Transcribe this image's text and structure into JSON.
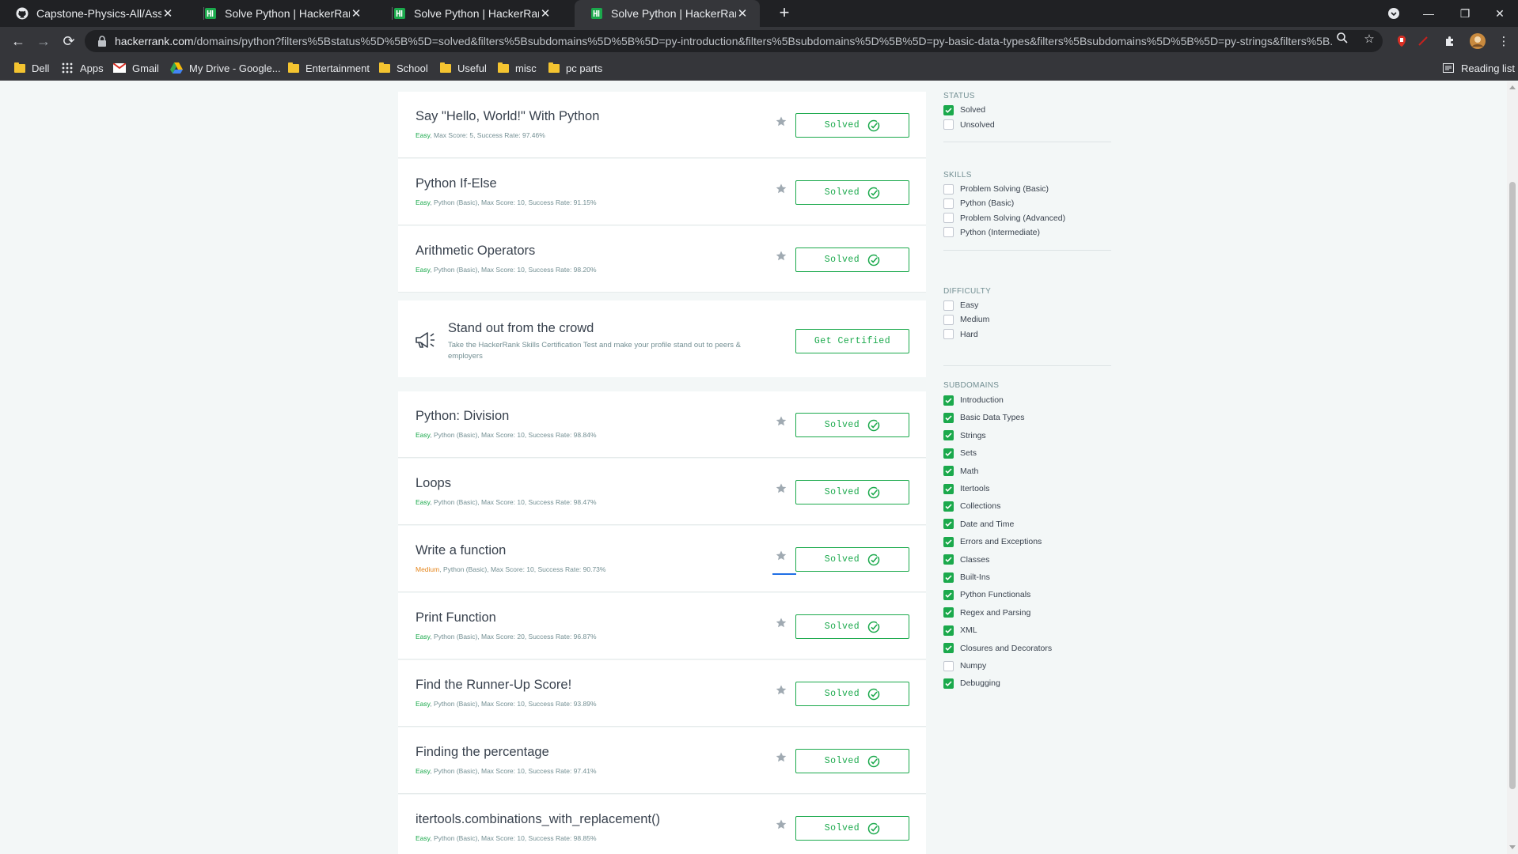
{
  "browser": {
    "tabs": [
      {
        "title": "Capstone-Physics-All/Assignmen",
        "icon": "github-icon",
        "active": false
      },
      {
        "title": "Solve Python | HackerRank",
        "icon": "hackerrank-icon",
        "active": false
      },
      {
        "title": "Solve Python | HackerRank",
        "icon": "hackerrank-icon",
        "active": false
      },
      {
        "title": "Solve Python | HackerRank",
        "icon": "hackerrank-icon",
        "active": true
      }
    ],
    "url_host": "hackerrank.com",
    "url_path": "/domains/python?filters%5Bstatus%5D%5B%5D=solved&filters%5Bsubdomains%5D%5B%5D=py-introduction&filters%5Bsubdomains%5D%5B%5D=py-basic-data-types&filters%5Bsubdomains%5D%5B%5D=py-strings&filters%5B...",
    "bookmarks": [
      "Dell",
      "Apps",
      "Gmail",
      "My Drive - Google...",
      "Entertainment",
      "School",
      "Useful",
      "misc",
      "pc parts"
    ],
    "reading_list": "Reading list",
    "colors": {
      "brand": "#1ba94c",
      "medium": "#e5861d",
      "frame": "#202124",
      "toolbar": "#35363a"
    }
  },
  "challenges": [
    {
      "title": "Say \"Hello, World!\" With Python",
      "difficulty": "Easy",
      "meta": ", Max Score: 5, Success Rate: 97.46%",
      "status": "Solved"
    },
    {
      "title": "Python If-Else",
      "difficulty": "Easy",
      "meta": ", Python (Basic), Max Score: 10, Success Rate: 91.15%",
      "status": "Solved"
    },
    {
      "title": "Arithmetic Operators",
      "difficulty": "Easy",
      "meta": ", Python (Basic), Max Score: 10, Success Rate: 98.20%",
      "status": "Solved"
    },
    {
      "title": "Python: Division",
      "difficulty": "Easy",
      "meta": ", Python (Basic), Max Score: 10, Success Rate: 98.84%",
      "status": "Solved"
    },
    {
      "title": "Loops",
      "difficulty": "Easy",
      "meta": ", Python (Basic), Max Score: 10, Success Rate: 98.47%",
      "status": "Solved"
    },
    {
      "title": "Write a function",
      "difficulty": "Medium",
      "meta": ", Python (Basic), Max Score: 10, Success Rate: 90.73%",
      "status": "Solved"
    },
    {
      "title": "Print Function",
      "difficulty": "Easy",
      "meta": ", Python (Basic), Max Score: 20, Success Rate: 96.87%",
      "status": "Solved"
    },
    {
      "title": "Find the Runner-Up Score!",
      "difficulty": "Easy",
      "meta": ", Python (Basic), Max Score: 10, Success Rate: 93.89%",
      "status": "Solved"
    },
    {
      "title": "Finding the percentage",
      "difficulty": "Easy",
      "meta": ", Python (Basic), Max Score: 10, Success Rate: 97.41%",
      "status": "Solved"
    },
    {
      "title": "itertools.combinations_with_replacement()",
      "difficulty": "Easy",
      "meta": ", Python (Basic), Max Score: 10, Success Rate: 98.85%",
      "status": "Solved"
    }
  ],
  "promo": {
    "title": "Stand out from the crowd",
    "description": "Take the HackerRank Skills Certification Test and make your profile stand out to peers & employers",
    "button": "Get Certified"
  },
  "filters": {
    "status": {
      "heading": "STATUS",
      "options": [
        {
          "label": "Solved",
          "checked": true
        },
        {
          "label": "Unsolved",
          "checked": false
        }
      ]
    },
    "skills": {
      "heading": "SKILLS",
      "options": [
        {
          "label": "Problem Solving (Basic)",
          "checked": false
        },
        {
          "label": "Python (Basic)",
          "checked": false
        },
        {
          "label": "Problem Solving (Advanced)",
          "checked": false
        },
        {
          "label": "Python (Intermediate)",
          "checked": false
        }
      ]
    },
    "difficulty": {
      "heading": "DIFFICULTY",
      "options": [
        {
          "label": "Easy",
          "checked": false
        },
        {
          "label": "Medium",
          "checked": false
        },
        {
          "label": "Hard",
          "checked": false
        }
      ]
    },
    "subdomains": {
      "heading": "SUBDOMAINS",
      "options": [
        {
          "label": "Introduction",
          "checked": true
        },
        {
          "label": "Basic Data Types",
          "checked": true
        },
        {
          "label": "Strings",
          "checked": true
        },
        {
          "label": "Sets",
          "checked": true
        },
        {
          "label": "Math",
          "checked": true
        },
        {
          "label": "Itertools",
          "checked": true
        },
        {
          "label": "Collections",
          "checked": true
        },
        {
          "label": "Date and Time",
          "checked": true
        },
        {
          "label": "Errors and Exceptions",
          "checked": true
        },
        {
          "label": "Classes",
          "checked": true
        },
        {
          "label": "Built-Ins",
          "checked": true
        },
        {
          "label": "Python Functionals",
          "checked": true
        },
        {
          "label": "Regex and Parsing",
          "checked": true
        },
        {
          "label": "XML",
          "checked": true
        },
        {
          "label": "Closures and Decorators",
          "checked": true
        },
        {
          "label": "Numpy",
          "checked": false
        },
        {
          "label": "Debugging",
          "checked": true
        }
      ]
    }
  }
}
